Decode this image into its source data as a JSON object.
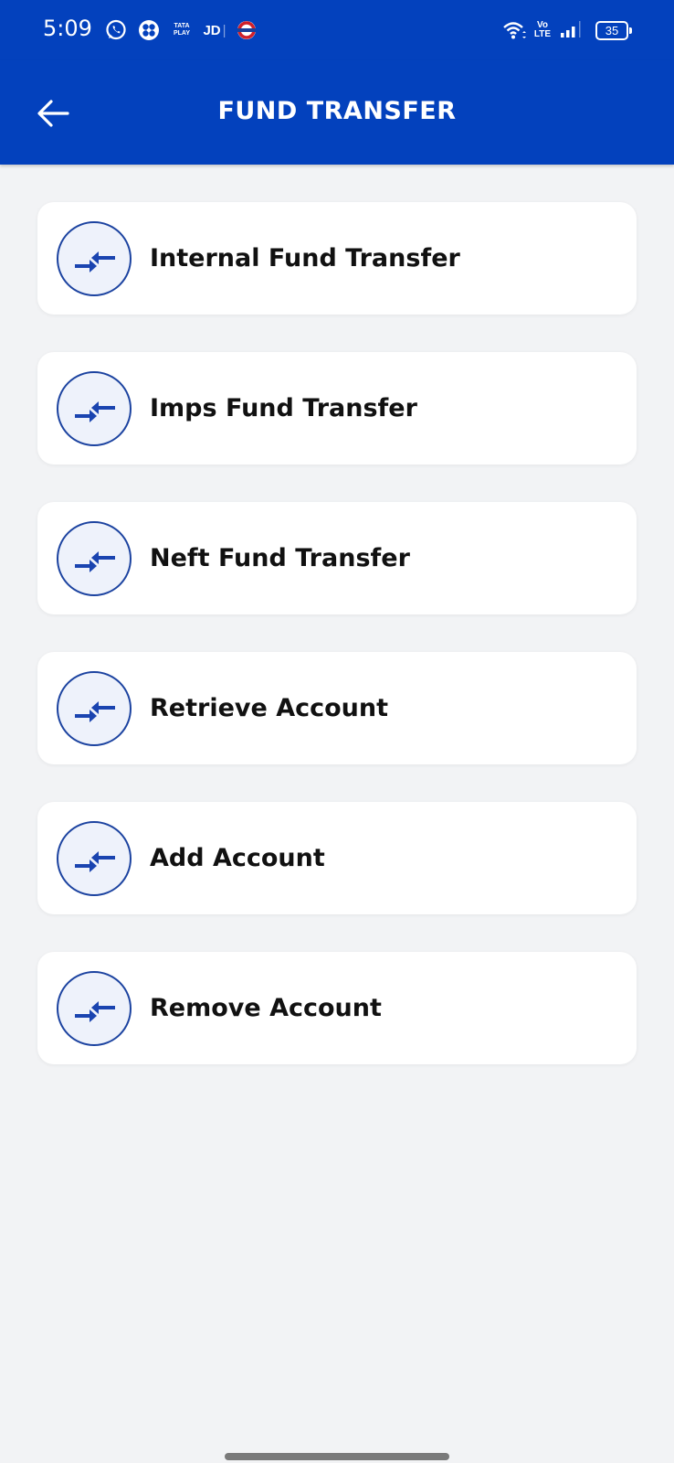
{
  "status_bar": {
    "time": "5:09",
    "notification_icons": [
      "whatsapp-icon",
      "clover-app-icon",
      "tata-play-icon",
      "jd-icon",
      "metro-icon"
    ],
    "tata_play_text": [
      "TATA",
      "PLAY"
    ],
    "jd_text": "JD",
    "volte_text": [
      "Vo",
      "LTE"
    ],
    "battery_level": "35"
  },
  "app_bar": {
    "title": "FUND TRANSFER",
    "back_icon": "arrow-left-icon"
  },
  "menu": {
    "items": [
      {
        "label": "Internal Fund Transfer",
        "icon": "transfer-arrows-icon"
      },
      {
        "label": "Imps Fund Transfer",
        "icon": "transfer-arrows-icon"
      },
      {
        "label": "Neft Fund Transfer",
        "icon": "transfer-arrows-icon"
      },
      {
        "label": "Retrieve Account",
        "icon": "transfer-arrows-icon"
      },
      {
        "label": "Add Account",
        "icon": "transfer-arrows-icon"
      },
      {
        "label": "Remove Account",
        "icon": "transfer-arrows-icon"
      }
    ]
  },
  "colors": {
    "primary": "#0341bd",
    "icon_blue": "#1c43a0",
    "background": "#f2f3f5"
  }
}
